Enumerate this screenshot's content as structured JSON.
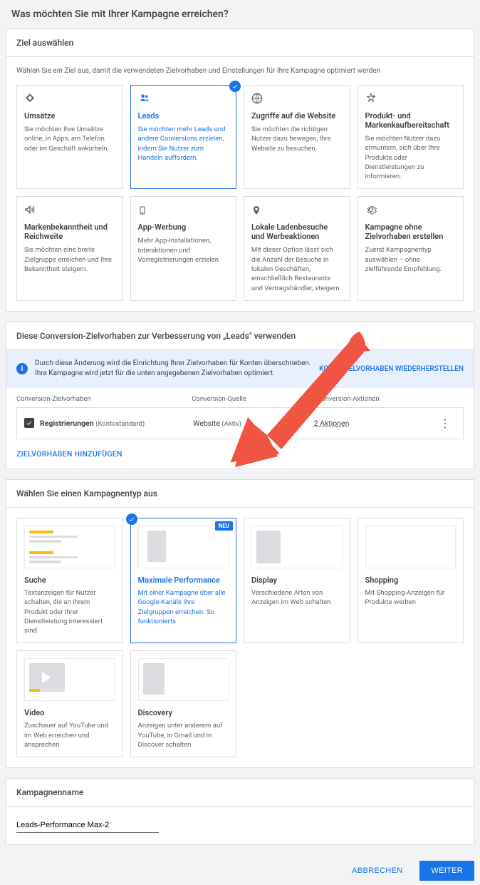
{
  "page_title": "Was möchten Sie mit Ihrer Kampagne erreichen?",
  "goal_section": {
    "header": "Ziel auswählen",
    "subtext": "Wählen Sie ein Ziel aus, damit die verwendeten Zielvorhaben und Einstellungen für Ihre Kampagne optimiert werden",
    "goals": [
      {
        "title": "Umsätze",
        "desc": "Sie möchten Ihre Umsätze online, in Apps, am Telefon oder im Geschäft ankurbeln."
      },
      {
        "title": "Leads",
        "desc": "Sie möchten mehr Leads und andere Conversions erzielen, indem Sie Nutzer zum Handeln auffordern.",
        "selected": true
      },
      {
        "title": "Zugriffe auf die Website",
        "desc": "Sie möchten die richtigen Nutzer dazu bewegen, Ihre Website zu besuchen."
      },
      {
        "title": "Produkt- und Markenkaufbereitschaft",
        "desc": "Sie möchten Nutzer dazu ermuntern, sich über Ihre Produkte oder Dienstleistungen zu informieren."
      },
      {
        "title": "Markenbekanntheit und Reichweite",
        "desc": "Sie möchten eine breite Zielgruppe erreichen und Ihre Bekanntheit steigern."
      },
      {
        "title": "App-Werbung",
        "desc": "Mehr App-Installationen, Interaktionen und Vorregistrierungen erzielen"
      },
      {
        "title": "Lokale Ladenbesuche und Werbeaktionen",
        "desc": "Mit dieser Option lässt sich die Anzahl der Besuche in lokalen Geschäften, einschließlich Restaurants und Vertragshändler, steigern."
      },
      {
        "title": "Kampagne ohne Zielvorhaben erstellen",
        "desc": "Zuerst Kampagnentyp auswählen – ohne zielführende Empfehlung."
      }
    ]
  },
  "conv_section": {
    "header": "Diese Conversion-Zielvorhaben zur Verbesserung von „Leads\" verwenden",
    "info_text": "Durch diese Änderung wird die Einrichtung Ihrer Zielvorhaben für Konten überschrieben. Ihre Kampagne wird jetzt für die unten angegebenen Zielvorhaben optimiert.",
    "info_link": "KONTOZIELVORHABEN WIEDERHERSTELLEN",
    "col1": "Conversion-Zielvorhaben",
    "col2": "Conversion-Quelle",
    "col3": "Conversion-Aktionen",
    "row_name": "Registrierungen",
    "row_sub": "(Kontostandard)",
    "row_source": "Website",
    "row_source_sub": "(Aktiv)",
    "row_actions": "2 Aktionen",
    "add_link": "ZIELVORHABEN HINZUFÜGEN"
  },
  "type_section": {
    "header": "Wählen Sie einen Kampagnentyp aus",
    "types": [
      {
        "title": "Suche",
        "desc": "Textanzeigen für Nutzer schalten, die an Ihrem Produkt oder Ihrer Dienstleistung interessiert sind"
      },
      {
        "title": "Maximale Performance",
        "desc": "Mit einer Kampagne über alle Google-Kanäle Ihre Zielgruppen erreichen.",
        "link": "So funktionierts",
        "selected": true,
        "neu": "NEU"
      },
      {
        "title": "Display",
        "desc": "Verschiedene Arten von Anzeigen im Web schalten"
      },
      {
        "title": "Shopping",
        "desc": "Mit Shopping-Anzeigen für Produkte werben"
      },
      {
        "title": "Video",
        "desc": "Zuschauer auf YouTube und im Web erreichen und ansprechen"
      },
      {
        "title": "Discovery",
        "desc": "Anzeigen unter anderem auf YouTube, in Gmail und in Discover schalten"
      }
    ]
  },
  "name_section": {
    "header": "Kampagnenname",
    "value": "Leads-Performance Max-2"
  },
  "footer": {
    "cancel": "ABBRECHEN",
    "next": "WEITER"
  }
}
